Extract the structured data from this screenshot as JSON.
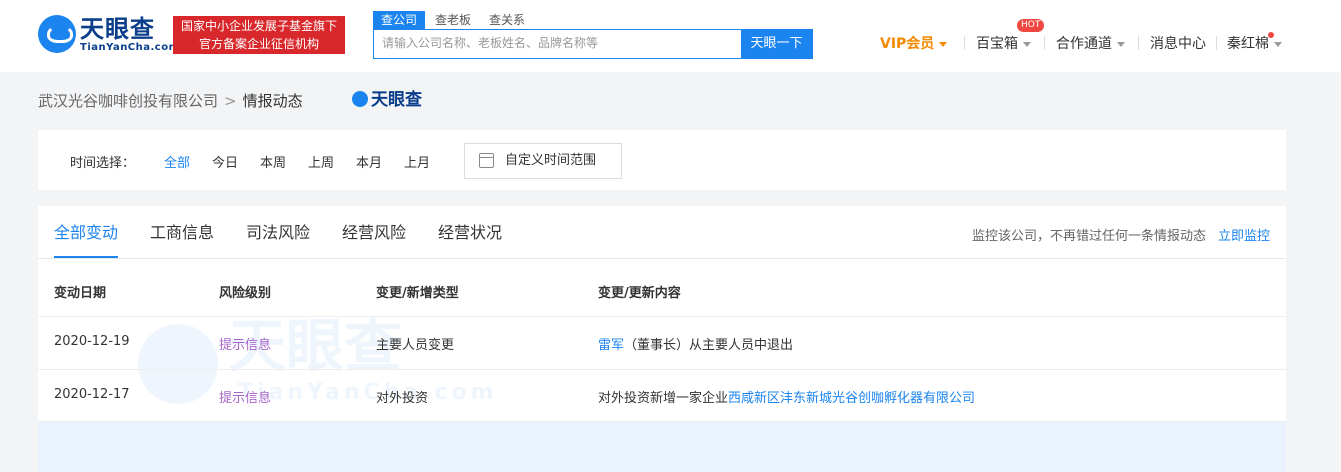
{
  "header": {
    "logo_cn": "天眼查",
    "logo_en": "TianYanCha.com",
    "badge_line1": "国家中小企业发展子基金旗下",
    "badge_line2": "官方备案企业征信机构",
    "search_tabs": [
      "查公司",
      "查老板",
      "查关系"
    ],
    "search_placeholder": "请输入公司名称、老板姓名、品牌名称等",
    "search_button": "天眼一下",
    "nav": {
      "vip": "VIP会员",
      "treasure": "百宝箱",
      "hot_badge": "HOT",
      "partner": "合作通道",
      "messages": "消息中心",
      "user": "秦红棉"
    }
  },
  "breadcrumb": {
    "company": "武汉光谷咖啡创投有限公司",
    "arrow": ">",
    "current": "情报动态",
    "logo": "天眼查"
  },
  "filter": {
    "label": "时间选择：",
    "options": [
      "全部",
      "今日",
      "本周",
      "上周",
      "本月",
      "上月"
    ],
    "custom_range": "自定义时间范围"
  },
  "tabs": [
    "全部变动",
    "工商信息",
    "司法风险",
    "经营风险",
    "经营状况"
  ],
  "monitor": {
    "text": "监控该公司，不再错过任何一条情报动态",
    "link": "立即监控"
  },
  "table": {
    "headers": [
      "变动日期",
      "风险级别",
      "变更/新增类型",
      "变更/更新内容"
    ],
    "rows": [
      {
        "date": "2020-12-19",
        "risk": "提示信息",
        "type": "主要人员变更",
        "content_link": "雷军",
        "content_text": "（董事长）从主要人员中退出"
      },
      {
        "date": "2020-12-17",
        "risk": "提示信息",
        "type": "对外投资",
        "content_text": "对外投资新增一家企业",
        "content_link": "西咸新区沣东新城光谷创咖孵化器有限公司"
      }
    ]
  },
  "watermark": {
    "cn": "天眼查",
    "en": "TianYanCha.com"
  },
  "colors": {
    "brand_blue": "#1b84ef",
    "risk_purple": "#a765c9",
    "vip_orange": "#f38a00",
    "badge_red": "#d8282b"
  }
}
